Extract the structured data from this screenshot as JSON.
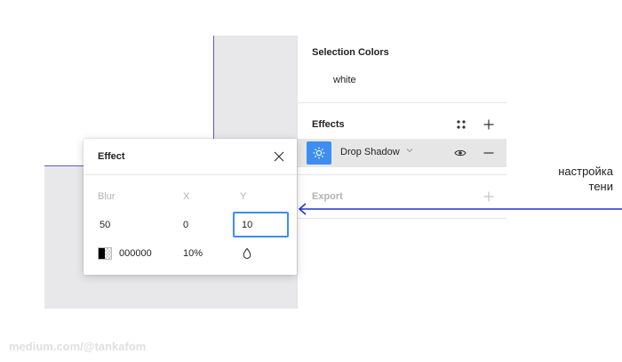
{
  "selection_colors": {
    "title": "Selection Colors",
    "value": "white"
  },
  "effects": {
    "title": "Effects",
    "styles_icon": "four-dots-icon",
    "add_icon": "plus-icon",
    "item": {
      "name": "Drop Shadow",
      "type_icon": "sun-icon",
      "visibility_icon": "eye-icon",
      "remove_icon": "minus-icon",
      "swatch_color": "#3d8ef0"
    }
  },
  "export": {
    "title": "Export",
    "add_icon": "plus-icon"
  },
  "effect_popover": {
    "title": "Effect",
    "close_icon": "close-icon",
    "labels": {
      "blur": "Blur",
      "x": "X",
      "y": "Y"
    },
    "values": {
      "blur": "50",
      "x": "0",
      "y": "10"
    },
    "color": {
      "hex": "000000",
      "opacity": "10%"
    },
    "blend_icon": "drop-icon"
  },
  "annotation": {
    "line1": "настройка",
    "line2": "тени",
    "arrow_color": "#2233cc"
  },
  "watermark": "medium.com/@tankafom"
}
